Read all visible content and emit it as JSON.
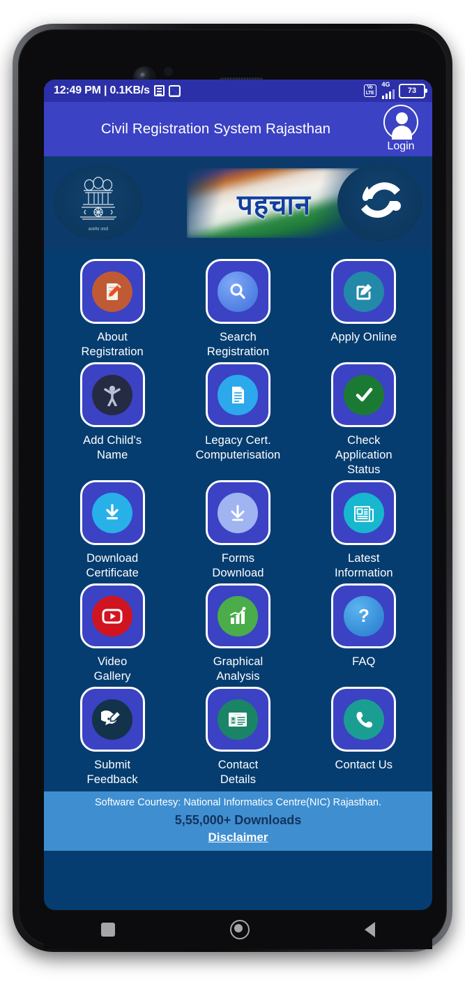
{
  "status_bar": {
    "time_and_speed": "12:49 PM | 0.1KB/s",
    "notification_icons": [
      "news-icon",
      "data-transfer-icon"
    ],
    "network_badge": "VoLTE",
    "network_type": "4G",
    "battery_level": "73"
  },
  "app_bar": {
    "title": "Civil Registration System Rajasthan",
    "login_label": "Login",
    "background_color": "#3b42c4"
  },
  "banner": {
    "left_logo": "india-national-emblem",
    "emblem_motto": "सत्यमेव जयते",
    "center_logo_text": "पहचान",
    "right_logo": "ciril-spiral-logo",
    "background_color": "#0c3b6b"
  },
  "grid": {
    "background_color": "#063d70",
    "items": [
      {
        "label": "About\nRegistration",
        "icon": "document-pen-icon",
        "icon_color": "#c05a34"
      },
      {
        "label": "Search\nRegistration",
        "icon": "magnifier-icon",
        "icon_color": "#5b8ef0"
      },
      {
        "label": "Apply Online",
        "icon": "edit-square-icon",
        "icon_color": "#2389a8"
      },
      {
        "label": "Add Child's\nName",
        "icon": "child-icon",
        "icon_color": "#262b44"
      },
      {
        "label": "Legacy Cert.\nComputerisation",
        "icon": "document-lines-icon",
        "icon_color": "#2ca8ec"
      },
      {
        "label": "Check\nApplication\nStatus",
        "icon": "check-circle-icon",
        "icon_color": "#1a7a33"
      },
      {
        "label": "Download\nCertificate",
        "icon": "download-bar-icon",
        "icon_color": "#28b0e8"
      },
      {
        "label": "Forms\nDownload",
        "icon": "download-arrow-icon",
        "icon_color": "#9fb4f0"
      },
      {
        "label": "Latest\nInformation",
        "icon": "newspaper-icon",
        "icon_color": "#17b7cf"
      },
      {
        "label": "Video\nGallery",
        "icon": "play-video-icon",
        "icon_color": "#d01521"
      },
      {
        "label": "Graphical\nAnalysis",
        "icon": "bar-chart-icon",
        "icon_color": "#4aad4a"
      },
      {
        "label": "FAQ",
        "icon": "question-mark-icon",
        "icon_color": "#2e93e0"
      },
      {
        "label": "Submit\nFeedback",
        "icon": "feedback-bubble-icon",
        "icon_color": "#12334a"
      },
      {
        "label": "Contact\nDetails",
        "icon": "id-card-icon",
        "icon_color": "#1a8466"
      },
      {
        "label": "Contact Us",
        "icon": "phone-icon",
        "icon_color": "#1a9e92"
      }
    ]
  },
  "footer": {
    "courtesy": "Software Courtesy: National Informatics Centre(NIC) Rajasthan.",
    "downloads": "5,55,000+ Downloads",
    "disclaimer": "Disclaimer",
    "background_color": "#3f8ed0"
  },
  "navigation_bar": {
    "recents": "recents-square-icon",
    "home": "home-circle-icon",
    "back": "back-triangle-icon"
  }
}
